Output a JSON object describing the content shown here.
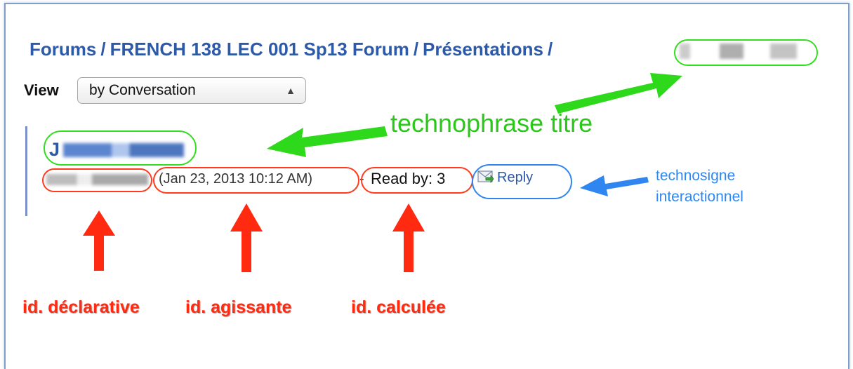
{
  "breadcrumb": {
    "forums": "Forums",
    "course_forum": "FRENCH 138 LEC 001 Sp13 Forum",
    "section": "Présentations",
    "separator": "/"
  },
  "view": {
    "label": "View",
    "selected": "by Conversation"
  },
  "post": {
    "title_initial": "J",
    "date": "(Jan 23, 2013 10:12 AM)",
    "dash": "-",
    "read_by": "Read by: 3",
    "reply_label": "Reply"
  },
  "annotations": {
    "technophrase": "technophrase titre",
    "technosigne_line1": "technosigne",
    "technosigne_line2": "interactionnel",
    "id_declarative": "id. déclarative",
    "id_agissante": "id. agissante",
    "id_calculee": "id. calculée"
  },
  "colors": {
    "link": "#2d5aa8",
    "green_annotation": "#2ac818",
    "red_annotation": "#ff2a10",
    "blue_annotation": "#2f86f0"
  }
}
